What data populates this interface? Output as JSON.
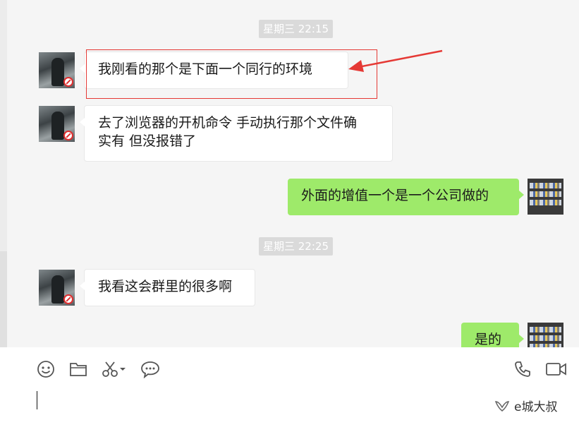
{
  "timestamps": [
    "星期三 22:15",
    "星期三 22:25"
  ],
  "messages": [
    {
      "side": "in",
      "lines": [
        "我刚看的那个是下面一个同行的环境"
      ]
    },
    {
      "side": "in",
      "lines": [
        "去了浏览器的开机命令 手动执行那个文件确",
        "实有 但没报错了"
      ]
    },
    {
      "side": "out",
      "lines": [
        "外面的增值一个是一个公司做的"
      ]
    },
    {
      "side": "in",
      "lines": [
        "我看这会群里的很多啊"
      ]
    },
    {
      "side": "out",
      "lines": [
        "是的"
      ]
    }
  ],
  "toolbar": {
    "left_icons": [
      "emoji-icon",
      "folder-icon",
      "scissors-icon",
      "chat-bubble-icon"
    ],
    "right_icons": [
      "phone-icon",
      "video-camera-icon"
    ]
  },
  "watermark": {
    "text": "e城大叔",
    "icon": "wechat-channel-icon"
  },
  "colors": {
    "outgoing_bubble": "#9eea6a",
    "incoming_bubble": "#ffffff",
    "annotation": "#e53935"
  }
}
